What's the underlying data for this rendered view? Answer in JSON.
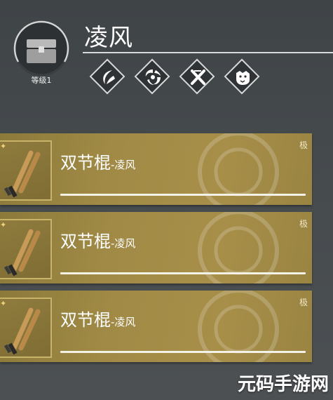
{
  "emblem": {
    "icon": "chest-icon",
    "level_label": "等级1"
  },
  "title": "凌风",
  "skills": [
    {
      "name": "crescent-slash-icon"
    },
    {
      "name": "whirlwind-icon"
    },
    {
      "name": "cross-strike-icon"
    },
    {
      "name": "tiger-head-icon"
    }
  ],
  "items": [
    {
      "name": "双节棍",
      "suffix": "-凌风",
      "rank": "极",
      "icon": "nunchaku-icon",
      "progress": 1.0
    },
    {
      "name": "双节棍",
      "suffix": "-凌风",
      "rank": "极",
      "icon": "nunchaku-icon",
      "progress": 1.0
    },
    {
      "name": "双节棍",
      "suffix": "-凌风",
      "rank": "极",
      "icon": "nunchaku-icon",
      "progress": 1.0
    }
  ],
  "watermark": "元码手游网",
  "colors": {
    "card_gold": "#a08a45",
    "progress_bar": "#f4f1e6",
    "background": "#464b4e"
  }
}
